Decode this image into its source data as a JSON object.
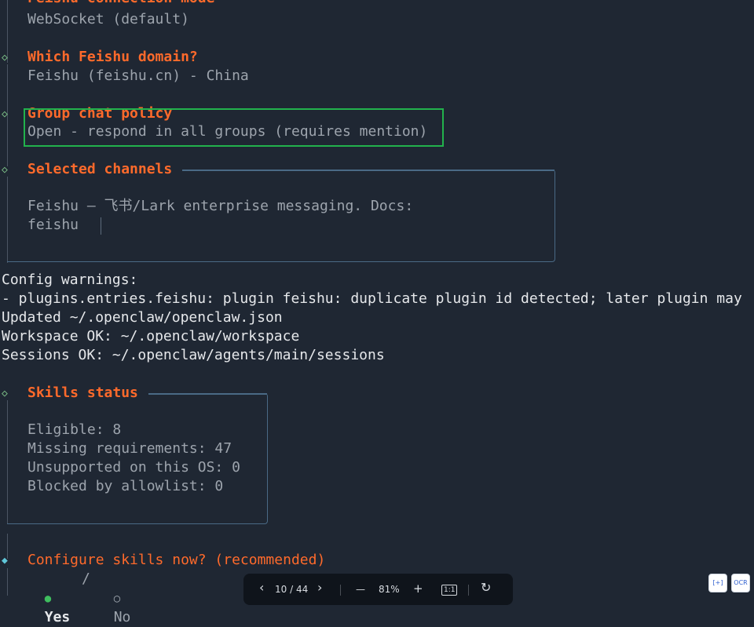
{
  "prev_step": {
    "title": "Feishu connection mode",
    "value": "WebSocket (default)"
  },
  "domain_step": {
    "title": "Which Feishu domain?",
    "value": "Feishu (feishu.cn) - China"
  },
  "group_step": {
    "title": "Group chat policy",
    "value": "Open - respond in all groups (requires mention)"
  },
  "channels": {
    "title": "Selected channels",
    "line1": "Feishu — 飞书/Lark enterprise messaging. Docs:",
    "line2": "feishu"
  },
  "config_log": [
    "Config warnings:",
    "- plugins.entries.feishu: plugin feishu: duplicate plugin id detected; later plugin may",
    "Updated ~/.openclaw/openclaw.json",
    "Workspace OK: ~/.openclaw/workspace",
    "Sessions OK: ~/.openclaw/agents/main/sessions"
  ],
  "skills": {
    "title": "Skills status",
    "eligible": "Eligible: 8",
    "missing": "Missing requirements: 47",
    "unsupported": "Unsupported on this OS: 0",
    "blocked": "Blocked by allowlist: 0"
  },
  "configure": {
    "question": "Configure skills now? (recommended)",
    "yes": "Yes",
    "separator": "/",
    "no": "No"
  },
  "toolbar": {
    "prev": "‹",
    "page": "10 / 44",
    "next": "›",
    "zoom_out": "—",
    "zoom": "81%",
    "zoom_in": "+",
    "actual_size": "1:1",
    "rotate": "↻"
  },
  "corner_buttons": {
    "select_text": "[+]",
    "ocr": "OCR"
  },
  "colors": {
    "background": "#1f2733",
    "accent_orange": "#ff6a2b",
    "highlight_green": "#22b24c",
    "radio_green": "#3fbf5f"
  }
}
